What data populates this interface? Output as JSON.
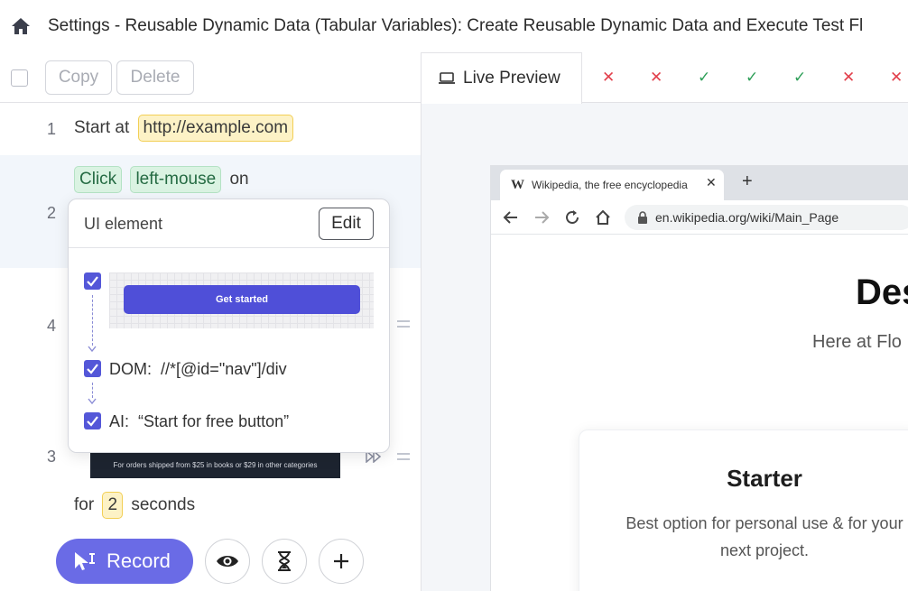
{
  "header": {
    "title": "Settings - Reusable Dynamic Data (Tabular Variables): Create Reusable Dynamic Data and Execute Test Fl"
  },
  "toolbar": {
    "copy_label": "Copy",
    "delete_label": "Delete"
  },
  "steps": [
    {
      "number": "1",
      "prefix": "Start at",
      "url": "http://example.com"
    },
    {
      "number": "2",
      "action": "Click",
      "button": "left-mouse",
      "suffix": "on"
    },
    {
      "number": "4"
    },
    {
      "number": "3",
      "prefix": "for",
      "value": "2",
      "suffix": "seconds",
      "thumb_text": "For orders shipped from $25 in books or $29 in other categories"
    }
  ],
  "popup": {
    "title": "UI element",
    "edit_label": "Edit",
    "thumb_button": "Get started",
    "dom_label": "DOM:",
    "dom_value": "//*[@id=\"nav\"]/div",
    "ai_label": "AI:",
    "ai_value": "“Start for free button”"
  },
  "actions": {
    "record_label": "Record"
  },
  "preview": {
    "tab_label": "Live Preview",
    "results": [
      "fail",
      "fail",
      "pass",
      "pass",
      "pass",
      "fail",
      "fail"
    ]
  },
  "browser": {
    "tab_title": "Wikipedia, the free encyclopedia",
    "favicon": "W",
    "url": "en.wikipedia.org/wiki/Main_Page"
  },
  "page": {
    "heading": "Des",
    "subheading": "Here at Flo",
    "card_title": "Starter",
    "card_desc": "Best option for personal use & for your next project."
  },
  "colors": {
    "accent": "#6a6be6",
    "checkbox": "#5457d8",
    "fail": "#e2404c",
    "pass": "#2e9f58"
  }
}
